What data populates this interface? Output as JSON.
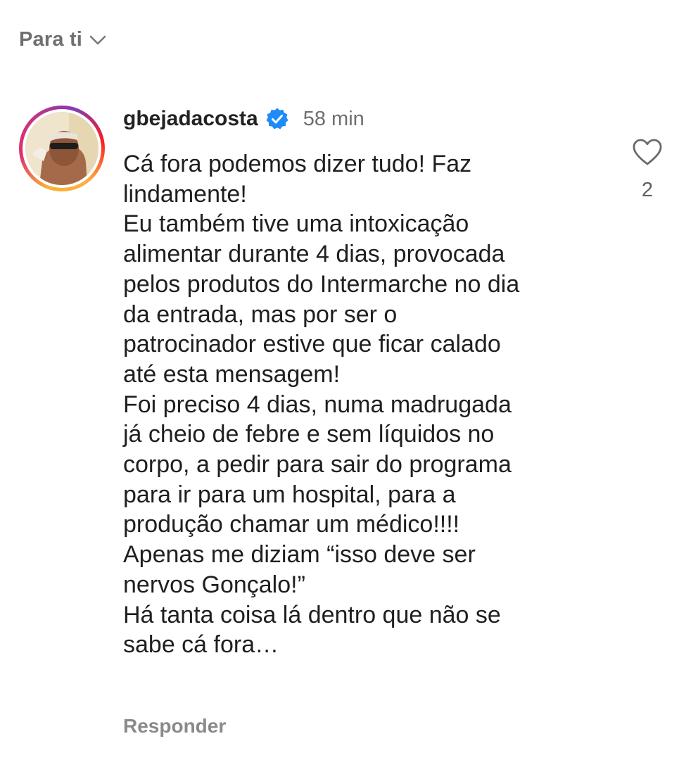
{
  "header": {
    "sort_label": "Para ti",
    "sort_icon": "chevron-down-icon"
  },
  "comment": {
    "username": "gbejadacosta",
    "verified": true,
    "time": "58 min",
    "avatar_icon": "profile-photo",
    "lines": [
      "Cá fora podemos dizer tudo! Faz",
      "lindamente!",
      "Eu também tive uma intoxicação",
      "alimentar durante 4 dias, provocada",
      "pelos produtos do Intermarche no dia",
      "da entrada, mas por ser o",
      "patrocinador estive que ficar calado",
      "até esta mensagem!",
      "Foi preciso 4 dias, numa madrugada",
      "já cheio de febre e sem líquidos no",
      "corpo, a pedir para sair do programa",
      "para ir para um hospital, para a",
      "produção chamar um médico!!!!",
      "Apenas me diziam “isso deve ser",
      "nervos Gonçalo!”",
      "Há tanta coisa lá dentro que não se",
      "sabe cá fora…"
    ],
    "reply_label": "Responder",
    "like_count": "2",
    "like_icon": "heart-outline-icon"
  },
  "colors": {
    "verified_badge": "#1d8cf8",
    "secondary_text": "#6f6f6f",
    "primary_text": "#1f1f1f"
  }
}
